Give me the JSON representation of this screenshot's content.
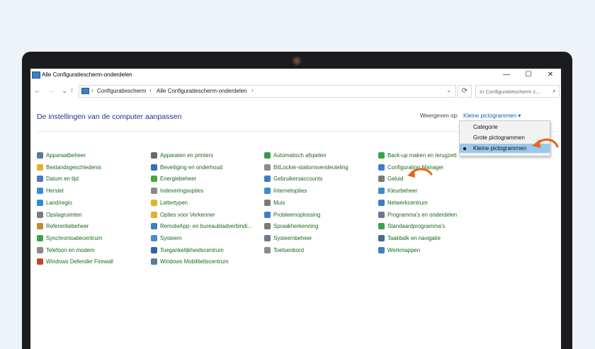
{
  "window": {
    "title": "Alle Configuratiescherm-onderdelen",
    "minimize": "—",
    "maximize": "☐",
    "close": "✕"
  },
  "nav": {
    "back": "←",
    "forward": "→",
    "recent": "⌄",
    "up": "↑"
  },
  "address": {
    "crumbs": [
      "Configuratiescherm",
      "Alle Configuratiescherm-onderdelen"
    ],
    "separator": "›",
    "dropdown": "⌄",
    "refresh": "⟳"
  },
  "search": {
    "placeholder": "In Configuratiescherm z...",
    "icon": "⌕"
  },
  "header": {
    "title": "De instellingen van de computer aanpassen",
    "view_by_label": "Weergeven op:",
    "view_by_value": "Kleine pictogrammen ▾"
  },
  "view_menu": {
    "options": [
      "Categorie",
      "Grote pictogrammen",
      "Kleine pictogrammen"
    ],
    "selected": "Kleine pictogrammen"
  },
  "columns": [
    {
      "items": [
        {
          "label": "Apparaatbeheer",
          "icon": "device-manager-icon",
          "color": "#5b7a9a"
        },
        {
          "label": "Bestandsgeschiedenis",
          "icon": "file-history-icon",
          "color": "#e3b12a"
        },
        {
          "label": "Datum en tijd",
          "icon": "clock-icon",
          "color": "#4a7bc0"
        },
        {
          "label": "Herstel",
          "icon": "recovery-icon",
          "color": "#3c8dd0"
        },
        {
          "label": "Land/regio",
          "icon": "globe-icon",
          "color": "#2e8bd6"
        },
        {
          "label": "Opslagruimten",
          "icon": "storage-icon",
          "color": "#7a7a7a"
        },
        {
          "label": "Referentiebeheer",
          "icon": "credential-icon",
          "color": "#c58b2e"
        },
        {
          "label": "Synchronisatiecentrum",
          "icon": "sync-icon",
          "color": "#3aa34a"
        },
        {
          "label": "Telefoon en modem",
          "icon": "phone-icon",
          "color": "#8a8a8a"
        },
        {
          "label": "Windows Defender Firewall",
          "icon": "firewall-icon",
          "color": "#c8442e"
        }
      ]
    },
    {
      "items": [
        {
          "label": "Apparaten en printers",
          "icon": "printer-icon",
          "color": "#6a6a6a"
        },
        {
          "label": "Beveiliging en onderhoud",
          "icon": "flag-icon",
          "color": "#2f6fc0"
        },
        {
          "label": "Energiebeheer",
          "icon": "power-icon",
          "color": "#4aa83a"
        },
        {
          "label": "Indexeringsopties",
          "icon": "index-icon",
          "color": "#8a8a8a"
        },
        {
          "label": "Lettertypen",
          "icon": "font-icon",
          "color": "#e3b12a"
        },
        {
          "label": "Opties voor Verkenner",
          "icon": "folder-options-icon",
          "color": "#e3b12a"
        },
        {
          "label": "RemoteApp- en bureaubladverbindi...",
          "icon": "remote-icon",
          "color": "#3c7fc4"
        },
        {
          "label": "Systeem",
          "icon": "system-icon",
          "color": "#4a8ad0"
        },
        {
          "label": "Toegankelijkheidscentrum",
          "icon": "accessibility-icon",
          "color": "#2d63b8"
        },
        {
          "label": "Windows Mobiliteitscentrum",
          "icon": "mobility-icon",
          "color": "#5b7a9a"
        }
      ]
    },
    {
      "items": [
        {
          "label": "Automatisch afspelen",
          "icon": "autoplay-icon",
          "color": "#3a9a4a"
        },
        {
          "label": "BitLocker-stationsversleuteling",
          "icon": "bitlocker-icon",
          "color": "#8a8a8a"
        },
        {
          "label": "Gebruikersaccounts",
          "icon": "users-icon",
          "color": "#3c7fc4"
        },
        {
          "label": "Internetopties",
          "icon": "internet-icon",
          "color": "#3c8dd0"
        },
        {
          "label": "Muis",
          "icon": "mouse-icon",
          "color": "#7a7a7a"
        },
        {
          "label": "Probleemoplossing",
          "icon": "troubleshoot-icon",
          "color": "#3c7fc4"
        },
        {
          "label": "Spraakherkenning",
          "icon": "microphone-icon",
          "color": "#7a7a7a"
        },
        {
          "label": "Systeembeheer",
          "icon": "admin-tools-icon",
          "color": "#6a7a8a"
        },
        {
          "label": "Toetsenbord",
          "icon": "keyboard-icon",
          "color": "#8a8a8a"
        }
      ]
    },
    {
      "items": [
        {
          "label": "Back-up maken en terugzett",
          "icon": "backup-icon",
          "color": "#3aa34a"
        },
        {
          "label": "Configuration Manager",
          "icon": "config-manager-icon",
          "color": "#3c7fc4"
        },
        {
          "label": "Geluid",
          "icon": "speaker-icon",
          "color": "#7a7a7a"
        },
        {
          "label": "Kleurbeheer",
          "icon": "color-icon",
          "color": "#3c8dd0"
        },
        {
          "label": "Netwerkcentrum",
          "icon": "network-icon",
          "color": "#3c7fc4"
        },
        {
          "label": "Programma's en onderdelen",
          "icon": "programs-icon",
          "color": "#6a7a8a"
        },
        {
          "label": "Standaardprogramma's",
          "icon": "default-programs-icon",
          "color": "#3aa34a"
        },
        {
          "label": "Taakbalk en navigatie",
          "icon": "taskbar-icon",
          "color": "#4a6a8a"
        },
        {
          "label": "Werkmappen",
          "icon": "work-folders-icon",
          "color": "#3c7fc4"
        }
      ]
    }
  ],
  "annotations": {
    "arrow_color": "#e8671c"
  }
}
